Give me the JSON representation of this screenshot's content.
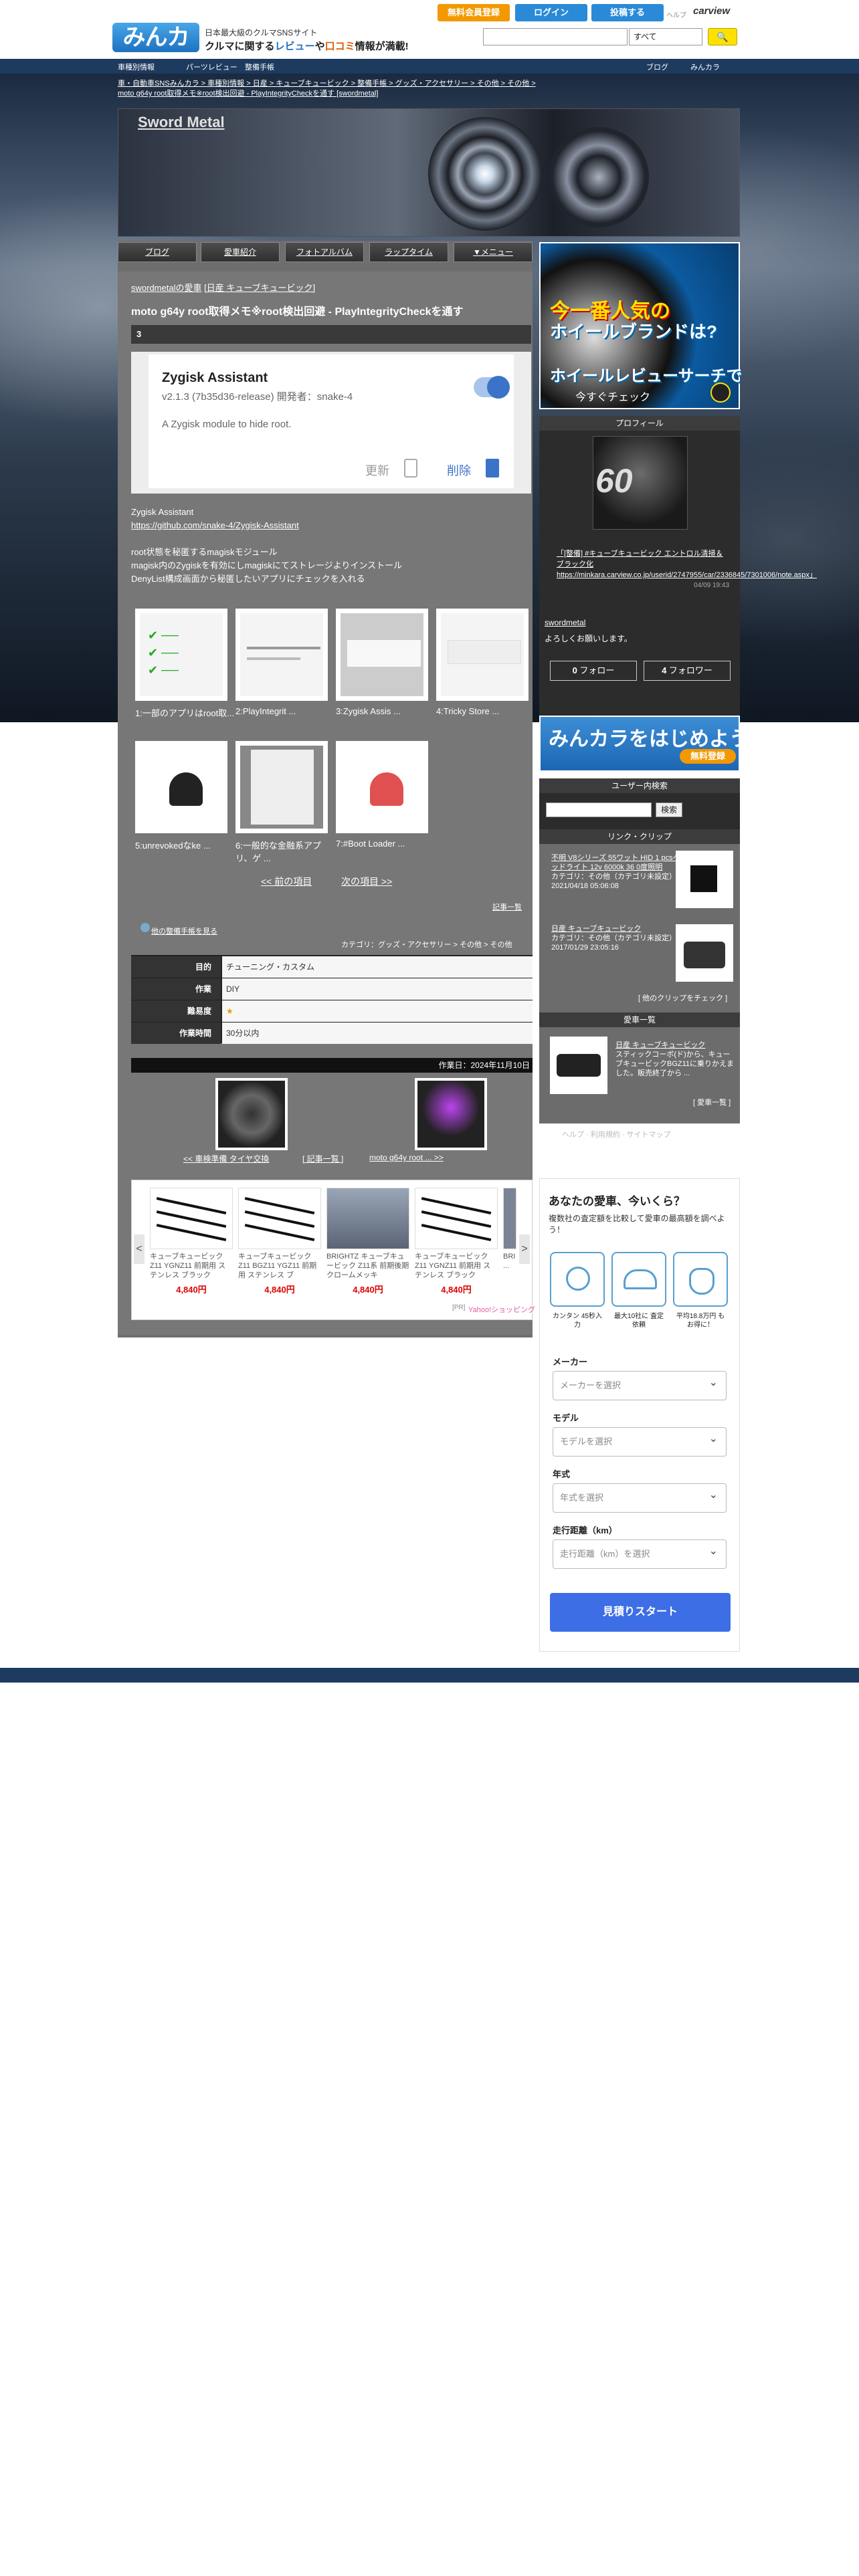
{
  "header": {
    "logo": "みんカラ",
    "tagline1": "日本最大級のクルマSNSサイト",
    "tagline2_a": "クルマに関する",
    "tagline2_b": "レビュー",
    "tagline2_c": "や",
    "tagline2_d": "口コミ",
    "tagline2_e": "情報が満載!",
    "register_btn": "無料会員登録",
    "login_btn": "ログイン",
    "post_btn": "投稿する",
    "help": "ヘルプ",
    "carview": "carview",
    "search_placeholder": "",
    "search_select": "すべて",
    "search_btn": "🔍"
  },
  "navbar": {
    "item1": "車種別情報",
    "item2": "パーツレビュー",
    "item3": "整備手帳",
    "right1": "ブログ",
    "right2": "みんカラ"
  },
  "breadcrumb": {
    "line1": "車・自動車SNSみんカラ > 車種別情報 > 日産 > キューブキュービック > 整備手帳 > グッズ・アクセサリー > その他 > その他 >",
    "line2": "moto g64y root取得メモ※root検出回避 - PlayIntegrityCheckを通す [swordmetal]"
  },
  "banner": {
    "title": "Sword Metal"
  },
  "tabs": [
    "ブログ",
    "愛車紹介",
    "フォトアルバム",
    "ラップタイム",
    "▼メニュー"
  ],
  "article": {
    "car_owner": "swordmetalの愛車",
    "car_model": "[日産 キューブキュービック]",
    "title": "moto g64y root取得メモ※root検出回避 - PlayIntegrityCheckを通す",
    "likes": "3",
    "app": {
      "name": "Zygisk Assistant",
      "version": "v2.1.3 (7b35d36-release) 開発者：snake-4",
      "description": "A Zygisk module to hide root.",
      "update": "更新",
      "delete": "削除"
    },
    "body": {
      "l1": "Zygisk Assistant",
      "l2": "https://github.com/snake-4/Zygisk-Assistant",
      "l3": "root状態を秘匿するmagiskモジュール",
      "l4": "magisk内のZygiskを有効にしmagiskにてストレージよりインストール",
      "l5": "DenyList構成画面から秘匿したいアプリにチェックを入れる"
    },
    "thumbs": [
      {
        "caption": "1:一部のアプリはroot取..."
      },
      {
        "caption": "2:PlayIntegrit ..."
      },
      {
        "caption": "3:Zygisk Assis ..."
      },
      {
        "caption": "4:Tricky Store ..."
      },
      {
        "caption": "5:unrevokedなke ..."
      },
      {
        "caption": "6:一般的な金融系アプリ、ゲ ..."
      },
      {
        "caption": "7:#Boot Loader ..."
      }
    ],
    "pager_prev": "<< 前の項目",
    "pager_next": "次の項目 >>",
    "more": "記事一覧",
    "other_steps": "他の整備手帳を見る",
    "category": "カテゴリ：グッズ・アクセサリー > その他 > その他",
    "spec": [
      {
        "label": "目的",
        "value": "チューニング・カスタム"
      },
      {
        "label": "作業",
        "value": "DIY"
      },
      {
        "label": "難易度",
        "value": "★"
      },
      {
        "label": "作業時間",
        "value": "30分以内"
      }
    ],
    "work_date": "作業日：2024年11月10日",
    "prev_link": "<< 車検準備 タイヤ交換",
    "archive_link": "[ 記事一覧 ]",
    "next_link": "moto g64y root ... >>"
  },
  "ads": {
    "products": [
      {
        "name": "キューブキュービック Z11 YGNZ11 前期用 ステンレス ブラック",
        "price": "4,840円"
      },
      {
        "name": "キューブキュービック Z11 BGZ11 YGZ11 前期用 ステンレス ブ",
        "price": "4,840円"
      },
      {
        "name": "BRIGHTZ キューブキュービック Z11系 前期後期 クロームメッキ",
        "price": "4,840円"
      },
      {
        "name": "キューブキュービック Z11 YGNZ11 前期用 ステンレス ブラック",
        "price": "4,840円"
      },
      {
        "name": "BRI ...",
        "price": ""
      }
    ],
    "pr": "[PR]",
    "brand": "Yahoo!ショッピング",
    "nav_left": "<",
    "nav_right": ">"
  },
  "sidebar": {
    "ad": {
      "h1": "今一番人気の",
      "h2": "ホイールブランドは?",
      "h3": "ホイールレビューサーチで",
      "h4": "今すぐチェック"
    },
    "profile": {
      "heading": "プロフィール",
      "img_text": "60",
      "car_line": "「[整備] #キューブキュービック エントロル清掃＆ブラック化 https://minkara.carview.co.jp/userid/2747955/car/2336845/7301006/note.aspx」",
      "date": "04/09 19:43",
      "name": "swordmetal",
      "bio": "よろしくお願いします。",
      "follow_count": "0",
      "follow_label": "フォロー",
      "follower_count": "4",
      "follower_label": "フォロワー"
    },
    "start_ad": {
      "text": "みんカラをはじめよう!",
      "pill": "無料登録"
    },
    "user_search": {
      "heading": "ユーザー内検索",
      "btn": "検索"
    },
    "clips": {
      "heading": "リンク・クリップ",
      "items": [
        {
          "title": "不明 V8シリーズ 55ワット HID 1 pcsヘッドライト 12v 6000k 36 0度照明",
          "cat": "カテゴリ：その他（カテゴリ未設定）",
          "date": "2021/04/18 05:06:08"
        },
        {
          "title": "日産 キューブキュービック",
          "cat": "カテゴリ：その他（カテゴリ未設定）",
          "date": "2017/01/29 23:05:16"
        }
      ],
      "more": "[ 他のクリップをチェック ]"
    },
    "car_list": {
      "heading": "愛車一覧",
      "title": "日産 キューブキュービック",
      "desc": "スティックコーボ(ド)から、キューブキュービックBGZ11に乗りかえました。販売終了から ...",
      "more": "[ 愛車一覧 ]"
    },
    "faint": "ヘルプ · 利用規約 · サイトマップ",
    "quote": {
      "title": "あなたの愛車、今いくら？",
      "sub": "複数社の査定額を比較して愛車の最高額を調べよう！",
      "icons": [
        {
          "caption": "カンタン 45秒入力"
        },
        {
          "caption": "最大10社に 査定依頼"
        },
        {
          "caption": "平均18.8万円 もお得に！"
        }
      ],
      "maker_label": "メーカー",
      "maker_placeholder": "メーカーを選択",
      "model_label": "モデル",
      "model_placeholder": "モデルを選択",
      "year_label": "年式",
      "year_placeholder": "年式を選択",
      "mileage_label": "走行距離（km）",
      "mileage_placeholder": "走行距離（km）を選択",
      "submit": "見積りスタート"
    }
  },
  "colors": {
    "accent": "#1e72c0",
    "orange": "#f39800",
    "nav": "#1d3a5f",
    "button_blue": "#3d6ee6",
    "price": "#dd0000"
  }
}
